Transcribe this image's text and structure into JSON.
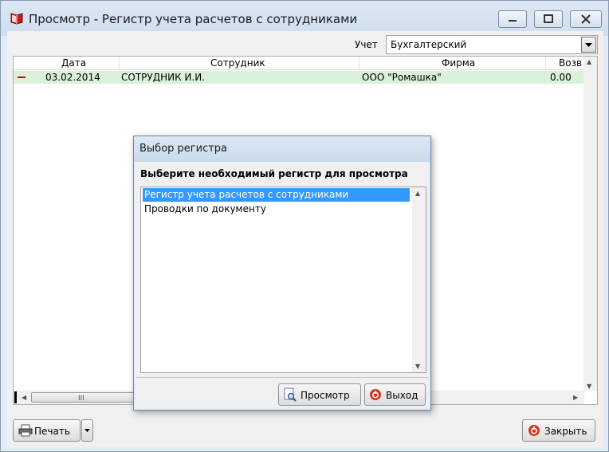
{
  "window": {
    "title": "Просмотр - Регистр учета расчетов с сотрудниками",
    "controls": [
      "minimize-icon",
      "maximize-icon",
      "close-icon"
    ]
  },
  "filter": {
    "label": "Учет",
    "value": "Бухгалтерский"
  },
  "grid": {
    "columns": [
      "Дата",
      "Сотрудник",
      "Фирма",
      "Возв"
    ],
    "rows": [
      {
        "date": "03.02.2014",
        "employee": "СОТРУДНИК И.И.",
        "firm": "ООО \"Ромашка\"",
        "amount": "0.00"
      }
    ],
    "row_color": "#d9f0d9"
  },
  "footer": {
    "print_label": "Печать",
    "close_label": "Закрыть"
  },
  "dialog": {
    "title": "Выбор регистра",
    "prompt": "Выберите необходимый регистр для просмотра",
    "items": [
      "Регистр учета расчетов с сотрудниками",
      "Проводки по документу"
    ],
    "selected_index": 0,
    "view_label": "Просмотр",
    "exit_label": "Выход",
    "selection_color": "#3399ff"
  }
}
